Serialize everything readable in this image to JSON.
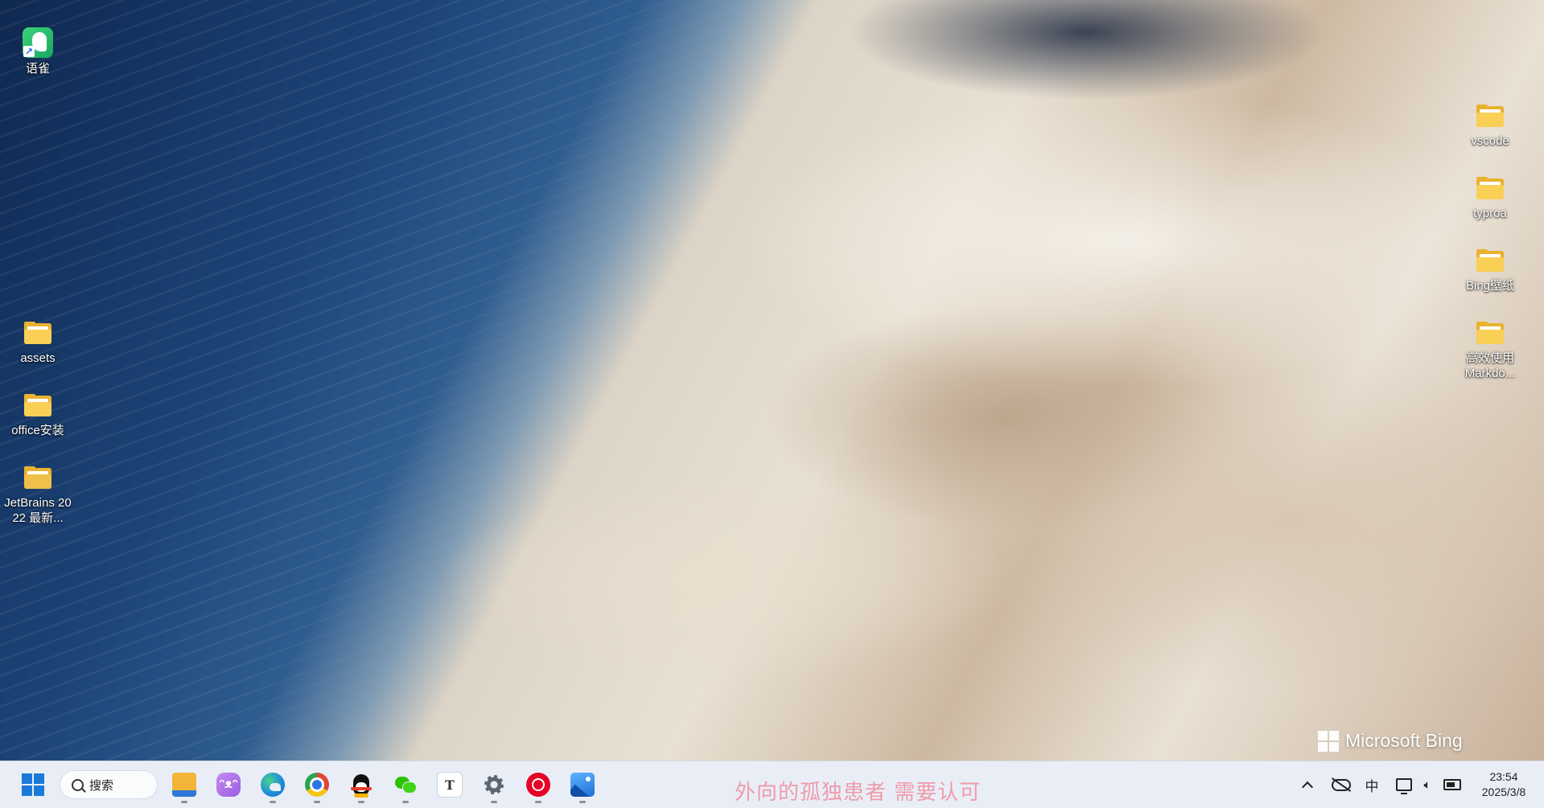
{
  "desktop": {
    "icons_left": [
      {
        "label": "语雀",
        "icon": "yuque-shortcut-icon"
      },
      {
        "label": "assets",
        "icon": "folder-icon"
      },
      {
        "label": "office安装",
        "icon": "folder-icon"
      },
      {
        "label": "JetBrains 2022 最新...",
        "icon": "folder-zip-icon"
      }
    ],
    "icons_right": [
      {
        "label": "vscode",
        "icon": "folder-icon"
      },
      {
        "label": "typroa",
        "icon": "folder-icon"
      },
      {
        "label": "Bing壁纸",
        "icon": "folder-icon"
      },
      {
        "label": "高效使用 Markdo...",
        "icon": "folder-icon"
      }
    ],
    "watermark": "Microsoft Bing"
  },
  "taskbar": {
    "search_label": "搜索",
    "marquee_text": "外向的孤独患者 需要认可",
    "pinned": [
      {
        "name": "file-explorer-icon",
        "color": "#f2b53a"
      },
      {
        "name": "cat-app-icon",
        "color": "#b77ee8"
      },
      {
        "name": "edge-icon",
        "color": "#1f8fd9"
      },
      {
        "name": "chrome-icon",
        "color": "#e0463a"
      },
      {
        "name": "qq-icon",
        "color": "#111111"
      },
      {
        "name": "wechat-icon",
        "color": "#2dc100"
      },
      {
        "name": "typora-icon",
        "color": "#333333",
        "glyph": "T"
      },
      {
        "name": "settings-icon",
        "color": "#5b6470"
      },
      {
        "name": "netease-music-icon",
        "color": "#e60026"
      },
      {
        "name": "photos-icon",
        "color": "#2d7fe0"
      }
    ],
    "tray": {
      "ime": "中"
    },
    "clock": {
      "time": "23:54",
      "date": "2025/3/8"
    }
  }
}
